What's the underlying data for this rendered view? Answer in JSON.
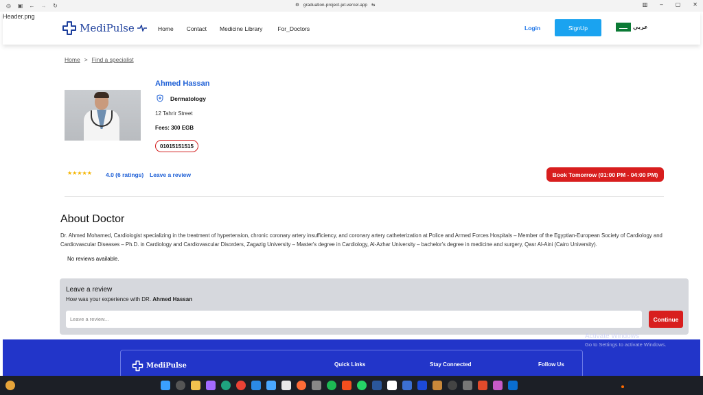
{
  "browser": {
    "url": "graduation-project-jet.vercel.app"
  },
  "broken_image_alt": "Header.png",
  "header": {
    "logo": "MediPulse",
    "nav": [
      "Home",
      "Contact",
      "Medicine Library",
      "For_Doctors"
    ],
    "login": "Login",
    "signup": "SignUp",
    "language": "عربي"
  },
  "breadcrumb": {
    "home": "Home",
    "separator": ">",
    "current": "Find a specialist"
  },
  "doctor": {
    "name": "Ahmed Hassan",
    "specialty": "Dermatology",
    "address": "12 Tahrir Street",
    "fees": "Fees: 300 EGB",
    "phone": "01015151515",
    "stars": "★★★★★",
    "rating": "4.0 (6 ratings)",
    "leave_review_link": "Leave a review",
    "book_button": "Book Tomorrow (01:00 PM - 04:00 PM)"
  },
  "about": {
    "title": "About Doctor",
    "text": "Dr. Ahmed Mohamed, Cardiologist specializing in the treatment of hypertension, chronic coronary artery insufficiency, and coronary artery catheterization at Police and Armed Forces Hospitals – Member of the Egyptian-European Society of Cardiology and Cardiovascular Diseases – Ph.D. in Cardiology and Cardiovascular Disorders, Zagazig University – Master's degree in Cardiology, Al-Azhar University – bachelor's degree in medicine and surgery, Qasr Al-Aini (Cairo University).",
    "no_reviews": "No reviews available."
  },
  "review": {
    "title": "Leave a review",
    "subtitle_prefix": "How was your experience with DR.",
    "subtitle_name": "Ahmed Hassan",
    "placeholder": "Leave a review...",
    "continue": "Continue"
  },
  "footer": {
    "logo": "MediPulse",
    "quick_links": "Quick Links",
    "stay_connected": "Stay Connected",
    "follow_us": "Follow Us"
  },
  "watermark": {
    "line1": "Activate Windows",
    "line2": "Go to Settings to activate Windows."
  },
  "colors": {
    "brand_blue": "#1d3f9c",
    "link_blue": "#1d5fd6",
    "accent_red": "#d81e1e",
    "signup_blue": "#1aa3f0",
    "footer_blue": "#2235c9"
  }
}
